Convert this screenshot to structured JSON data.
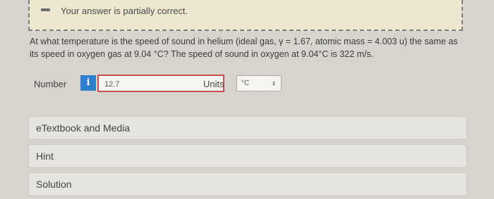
{
  "feedback": {
    "icon": "minus-icon",
    "text": "Your answer is partially correct."
  },
  "question": {
    "text_line1": "At what temperature is the speed of sound in helium (ideal gas, γ = 1.67, atomic mass = 4.003 u) the same as",
    "text_line2": "its speed in oxygen gas at 9.04 °C? The speed of sound in oxygen at 9.04°C is 322 m/s."
  },
  "answer": {
    "number_label": "Number",
    "info_icon_text": "i",
    "value": "12.7",
    "units_label": "Units",
    "units_value": "°C",
    "chevron_icon": "updown-chevron-icon"
  },
  "panels": {
    "etextbook": "eTextbook and Media",
    "hint": "Hint",
    "solution": "Solution"
  },
  "colors": {
    "feedback_bg": "#ece8cf",
    "info_badge": "#2f7fd0",
    "input_border": "#c85050"
  }
}
